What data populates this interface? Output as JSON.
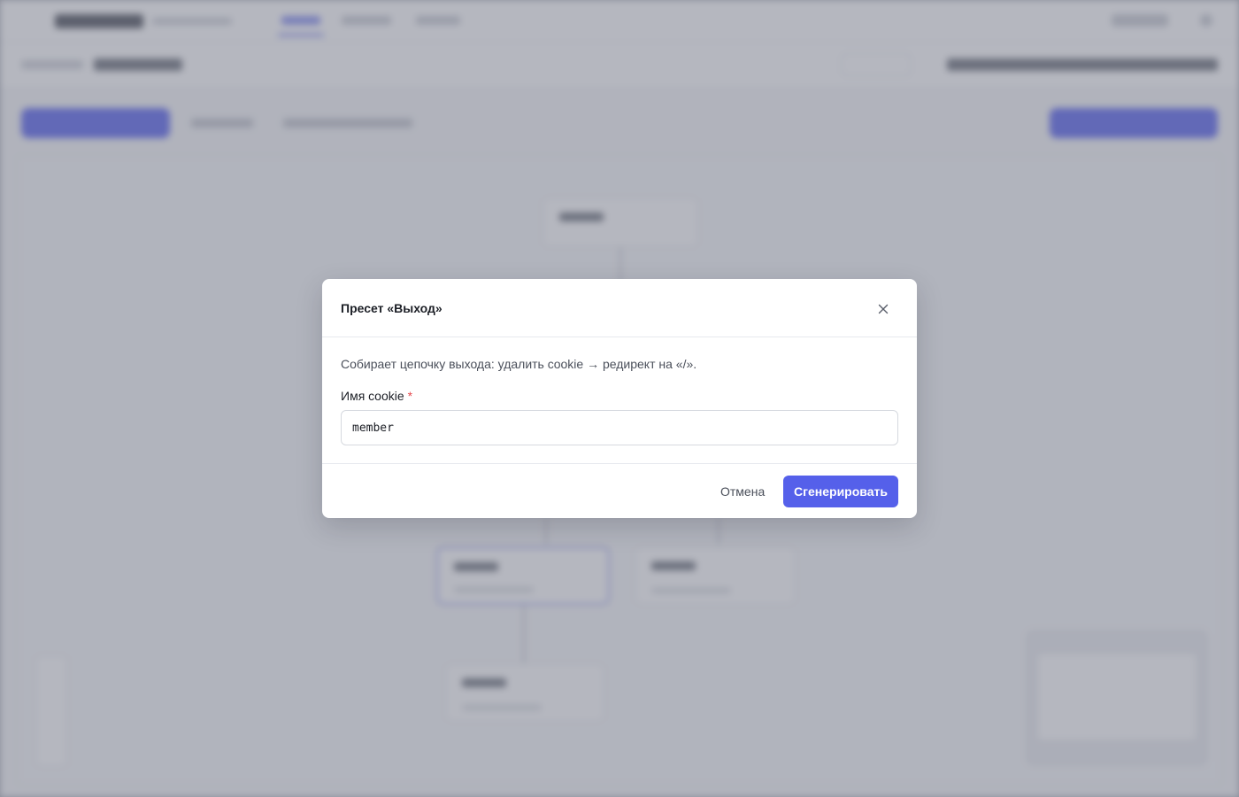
{
  "modal": {
    "title": "Пресет «Выход»",
    "description": "Собирает цепочку выхода: удалить cookie → редирект на «/».",
    "field": {
      "label": "Имя cookie",
      "required_marker": "*",
      "value": "member",
      "placeholder": ""
    },
    "cancel_label": "Отмена",
    "submit_label": "Сгенерировать"
  },
  "colors": {
    "accent": "#5560ea",
    "required": "#e5484d",
    "overlay": "#787c8a"
  },
  "icons": {
    "close": "close-icon"
  }
}
